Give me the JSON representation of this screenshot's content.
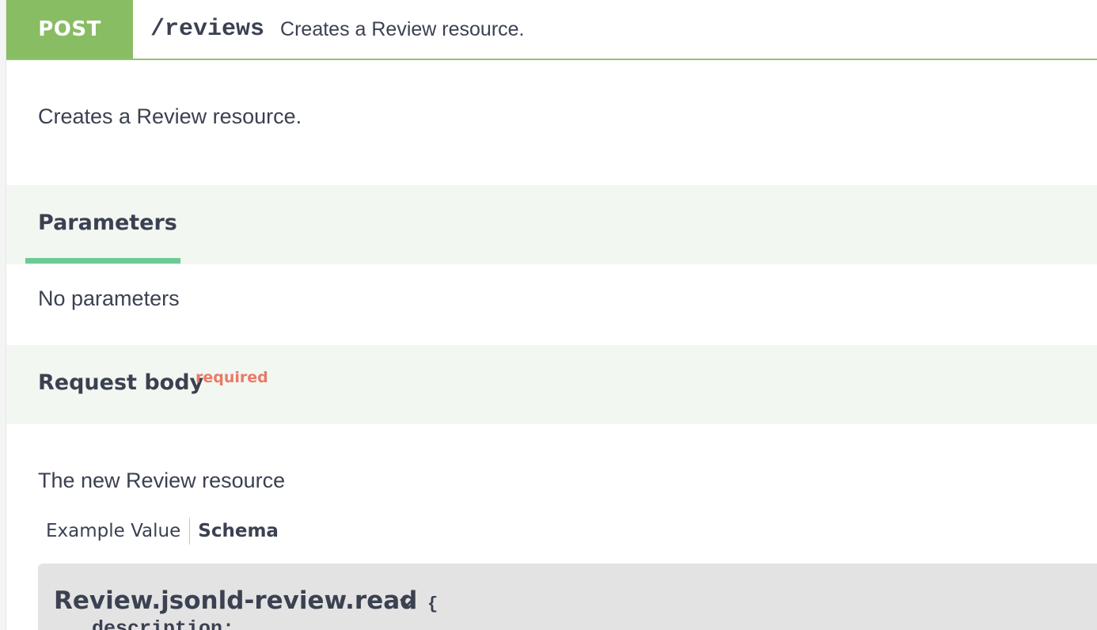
{
  "operation": {
    "method": "POST",
    "path": "/reviews",
    "summary": "Creates a Review resource.",
    "description": "Creates a Review resource.",
    "method_color": "#88bd63"
  },
  "parameters": {
    "title": "Parameters",
    "empty_text": "No parameters"
  },
  "request_body": {
    "title": "Request body",
    "required_label": "required",
    "description": "The new Review resource",
    "tabs": [
      {
        "label": "Example Value",
        "active": false
      },
      {
        "label": "Schema",
        "active": true
      }
    ]
  },
  "schema": {
    "name": "Review.jsonld-review.read",
    "open_brace": "{",
    "fields": [
      "description:"
    ],
    "toggle_icon": "chevron-down-icon"
  },
  "colors": {
    "accent_green": "#88bd63",
    "tab_underline": "#6bcb93",
    "required_red": "#e97a68",
    "section_bg": "#f2f7f1"
  }
}
